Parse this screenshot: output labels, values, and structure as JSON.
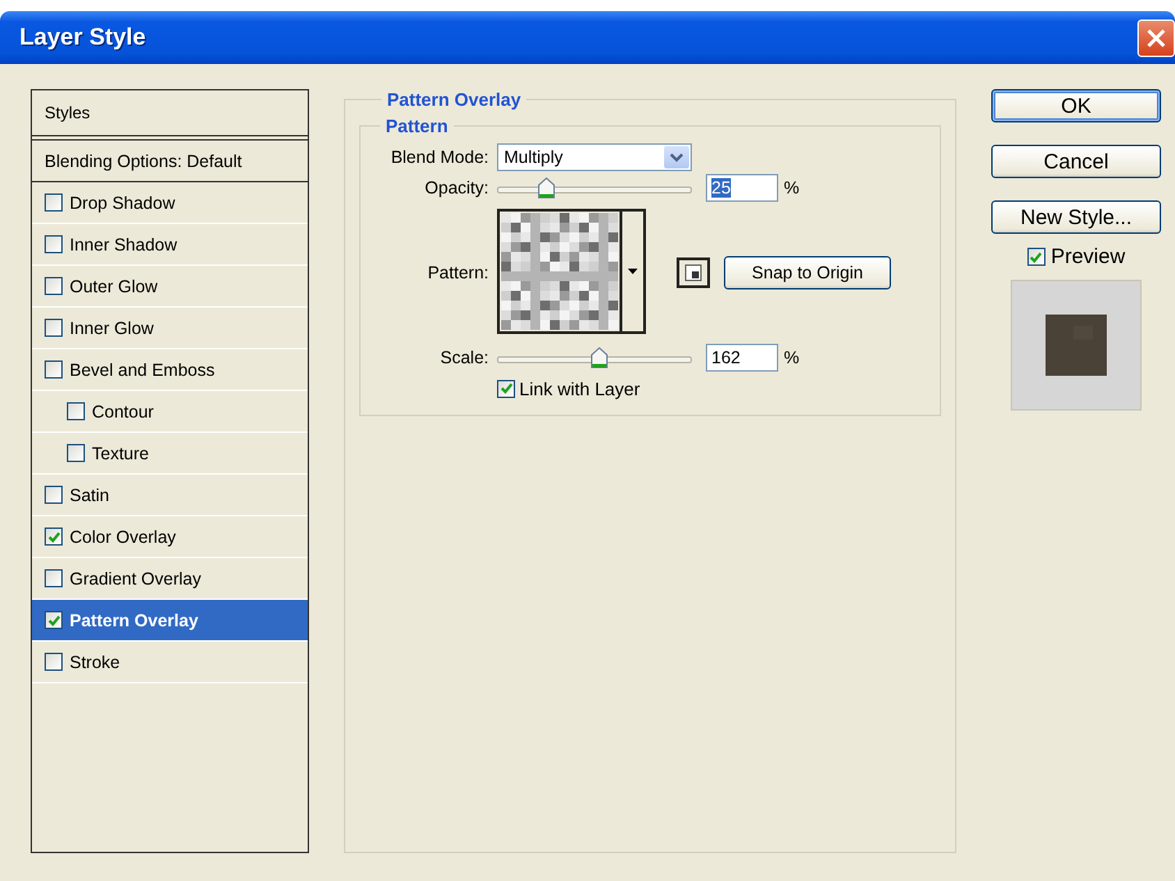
{
  "window": {
    "title": "Layer Style"
  },
  "styles_list": {
    "header": "Styles",
    "items": [
      {
        "kind": "plain",
        "label": "Blending Options: Default",
        "selected": false
      },
      {
        "kind": "checkbox",
        "label": "Drop Shadow",
        "checked": false,
        "selected": false
      },
      {
        "kind": "checkbox",
        "label": "Inner Shadow",
        "checked": false,
        "selected": false
      },
      {
        "kind": "checkbox",
        "label": "Outer Glow",
        "checked": false,
        "selected": false
      },
      {
        "kind": "checkbox",
        "label": "Inner Glow",
        "checked": false,
        "selected": false
      },
      {
        "kind": "checkbox",
        "label": "Bevel and Emboss",
        "checked": false,
        "selected": false,
        "children": [
          {
            "kind": "checkbox",
            "label": "Contour",
            "checked": false,
            "selected": false
          },
          {
            "kind": "checkbox",
            "label": "Texture",
            "checked": false,
            "selected": false
          }
        ]
      },
      {
        "kind": "checkbox",
        "label": "Satin",
        "checked": false,
        "selected": false
      },
      {
        "kind": "checkbox",
        "label": "Color Overlay",
        "checked": true,
        "selected": false
      },
      {
        "kind": "checkbox",
        "label": "Gradient Overlay",
        "checked": false,
        "selected": false
      },
      {
        "kind": "checkbox",
        "label": "Pattern Overlay",
        "checked": true,
        "selected": true
      },
      {
        "kind": "checkbox",
        "label": "Stroke",
        "checked": false,
        "selected": false
      }
    ]
  },
  "panel": {
    "title": "Pattern Overlay",
    "group": "Pattern",
    "blend_mode": {
      "label": "Blend Mode:",
      "value": "Multiply"
    },
    "opacity": {
      "label": "Opacity:",
      "level": 0.25,
      "value": "25",
      "unit": "%",
      "highlighted": true
    },
    "pattern": {
      "label": "Pattern:"
    },
    "snap_button": "Snap to Origin",
    "scale": {
      "label": "Scale:",
      "level": 0.52,
      "value": "162",
      "unit": "%",
      "highlighted": false
    },
    "link": {
      "label": "Link with Layer",
      "checked": true
    }
  },
  "buttons": [
    {
      "label": "OK",
      "default": true
    },
    {
      "label": "Cancel",
      "default": false
    },
    {
      "label": "New Style...",
      "default": false
    }
  ],
  "preview": {
    "label": "Preview",
    "checked": true
  }
}
